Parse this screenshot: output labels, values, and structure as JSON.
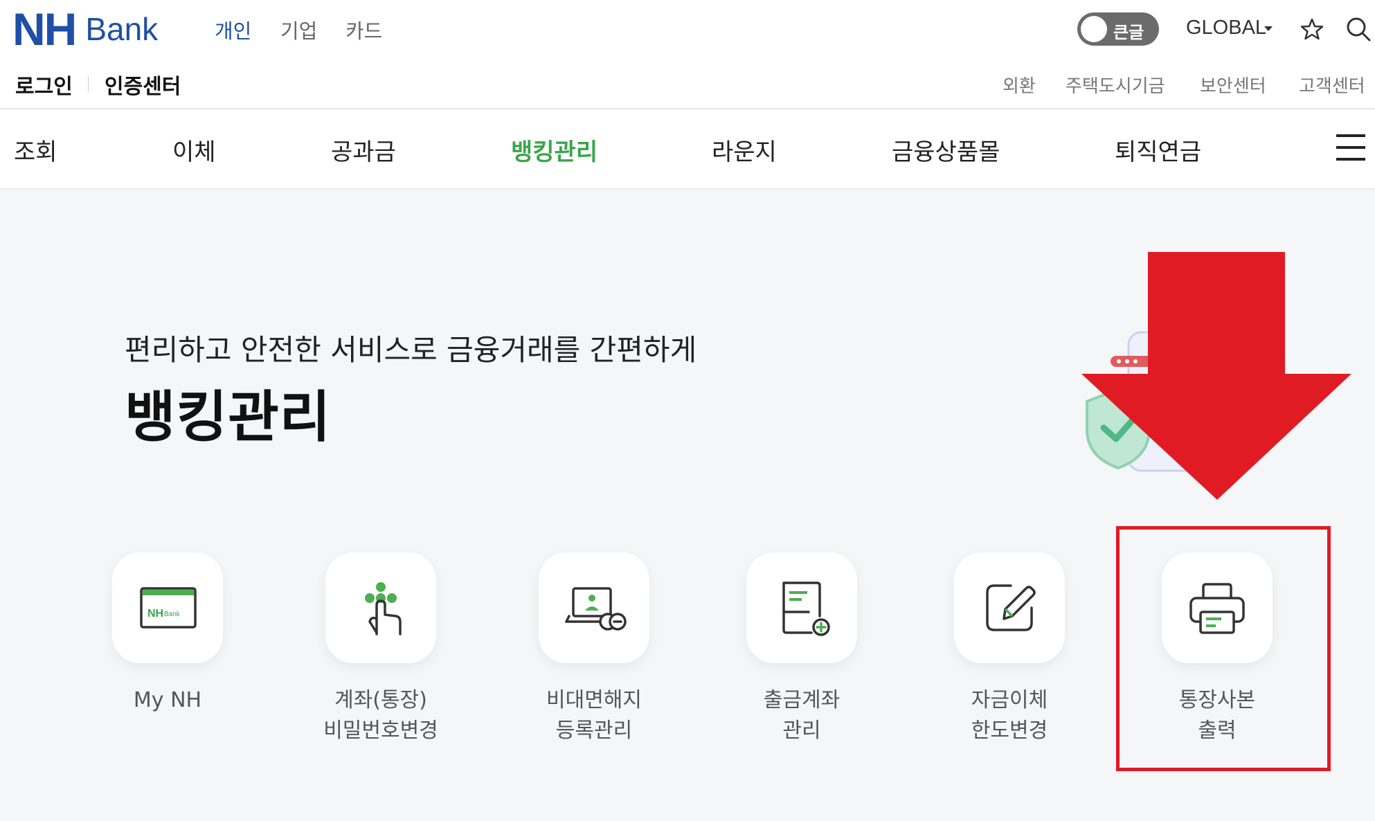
{
  "header": {
    "logo_nh": "NH",
    "logo_bank": "Bank",
    "segments": [
      "개인",
      "기업",
      "카드"
    ],
    "active_segment": "개인",
    "toggle_label": "큰글",
    "global_label": "GLOBAL",
    "icons": [
      "star-icon",
      "search-icon"
    ]
  },
  "subbar": {
    "left_links": [
      "로그인",
      "인증센터"
    ],
    "right_links": [
      "외환",
      "주택도시기금",
      "보안센터",
      "고객센터"
    ]
  },
  "menu": {
    "items": [
      "조회",
      "이체",
      "공과금",
      "뱅킹관리",
      "라운지",
      "금융상품몰",
      "퇴직연금"
    ],
    "active": "뱅킹관리",
    "menu_icon": "hamburger-icon"
  },
  "hero": {
    "subtitle": "편리하고 안전한 서비스로 금융거래를 간편하게",
    "title": "뱅킹관리"
  },
  "services": [
    {
      "label_1": "My NH",
      "label_2": "",
      "icon": "nh-card-icon"
    },
    {
      "label_1": "계좌(통장)",
      "label_2": "비밀번호변경",
      "icon": "hand-touch-icon"
    },
    {
      "label_1": "비대면해지",
      "label_2": "등록관리",
      "icon": "laptop-user-icon"
    },
    {
      "label_1": "출금계좌",
      "label_2": "관리",
      "icon": "document-add-icon"
    },
    {
      "label_1": "자금이체",
      "label_2": "한도변경",
      "icon": "edit-pen-icon"
    },
    {
      "label_1": "통장사본",
      "label_2": "출력",
      "icon": "printer-icon"
    }
  ],
  "colors": {
    "brand_blue": "#1f4fa6",
    "active_green": "#3aa54a",
    "annotation_red": "#e01b24"
  }
}
